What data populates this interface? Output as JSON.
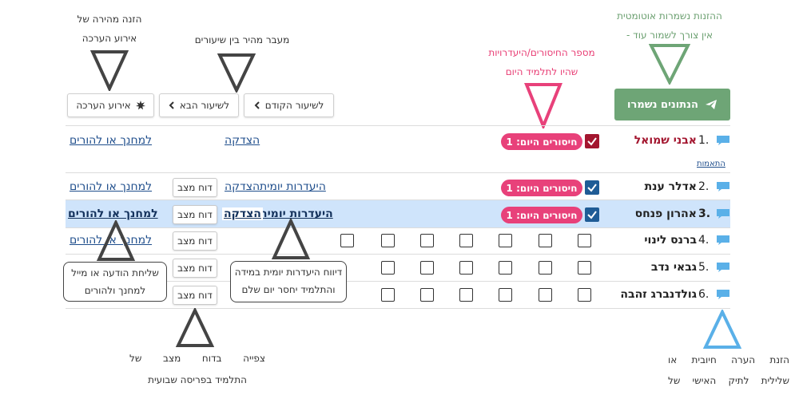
{
  "annotations": {
    "assessment_event": [
      "הזנה מהירה של",
      "אירוע הערכה"
    ],
    "lesson_nav": "מעבר מהיר בין שיעורים",
    "absence_count": [
      "מספר החיסורים/היעדרויות",
      "שהיו לתלמיד היום"
    ],
    "auto_save": [
      "ההזנות נשמרות אוטומטית",
      "- אין צורך לשמור עוד"
    ],
    "send_message": [
      "שליחת הודעה או מייל",
      "למחנך ולהורים"
    ],
    "daily_absence": [
      "דיווח היעדרות יומית במידה",
      "והתלמיד יחסר יום שלם"
    ],
    "status_report": [
      "צפייה בדוח מצב של",
      "התלמיד בפריסה שבועית"
    ],
    "personal_note": [
      "הזנת הערה חיובית או",
      "שלילית לתיק האישי של"
    ]
  },
  "toolbar": {
    "assessment_event_label": "אירוע הערכה",
    "next_lesson_label": "לשיעור הבא",
    "prev_lesson_label": "לשיעור הקודם",
    "save_label": "הנתונים נשמרו"
  },
  "colors": {
    "save_green": "#6ea576",
    "absence_pink": "#e8417a",
    "row_highlight": "#cfe4fb",
    "link_blue": "#1f4e8c",
    "checked_blue": "#1f5c96",
    "checked_red": "#a3162f"
  },
  "students": [
    {
      "num": "1.",
      "name": "אבני שמואל",
      "checked": true,
      "absences": "חיסורים היום: 1",
      "tag": "התאמות"
    },
    {
      "num": "2.",
      "name": "אדלר ענת",
      "checked": true,
      "absences": "חיסורים היום: 1"
    },
    {
      "num": "3.",
      "name": "אהרון פנחס",
      "checked": true,
      "absences": "חיסורים היום: 1"
    },
    {
      "num": "4.",
      "name": "ברנס לינוי",
      "checked": false
    },
    {
      "num": "5.",
      "name": "גבאי נדב",
      "checked": false
    },
    {
      "num": "6.",
      "name": "גולדנברג זהבה",
      "checked": false
    }
  ],
  "row_actions": {
    "praise": "הצדקה",
    "daily_absence": "היעדרות יומית",
    "status_report": "דוח מצב",
    "to_teacher_parents": "למחנך או להורים"
  },
  "icons": {
    "comment": "speech-bubble-icon",
    "send": "paper-plane-icon",
    "assessment": "starburst-icon",
    "next": "chevron-left-icon",
    "prev": "chevron-left-icon"
  }
}
